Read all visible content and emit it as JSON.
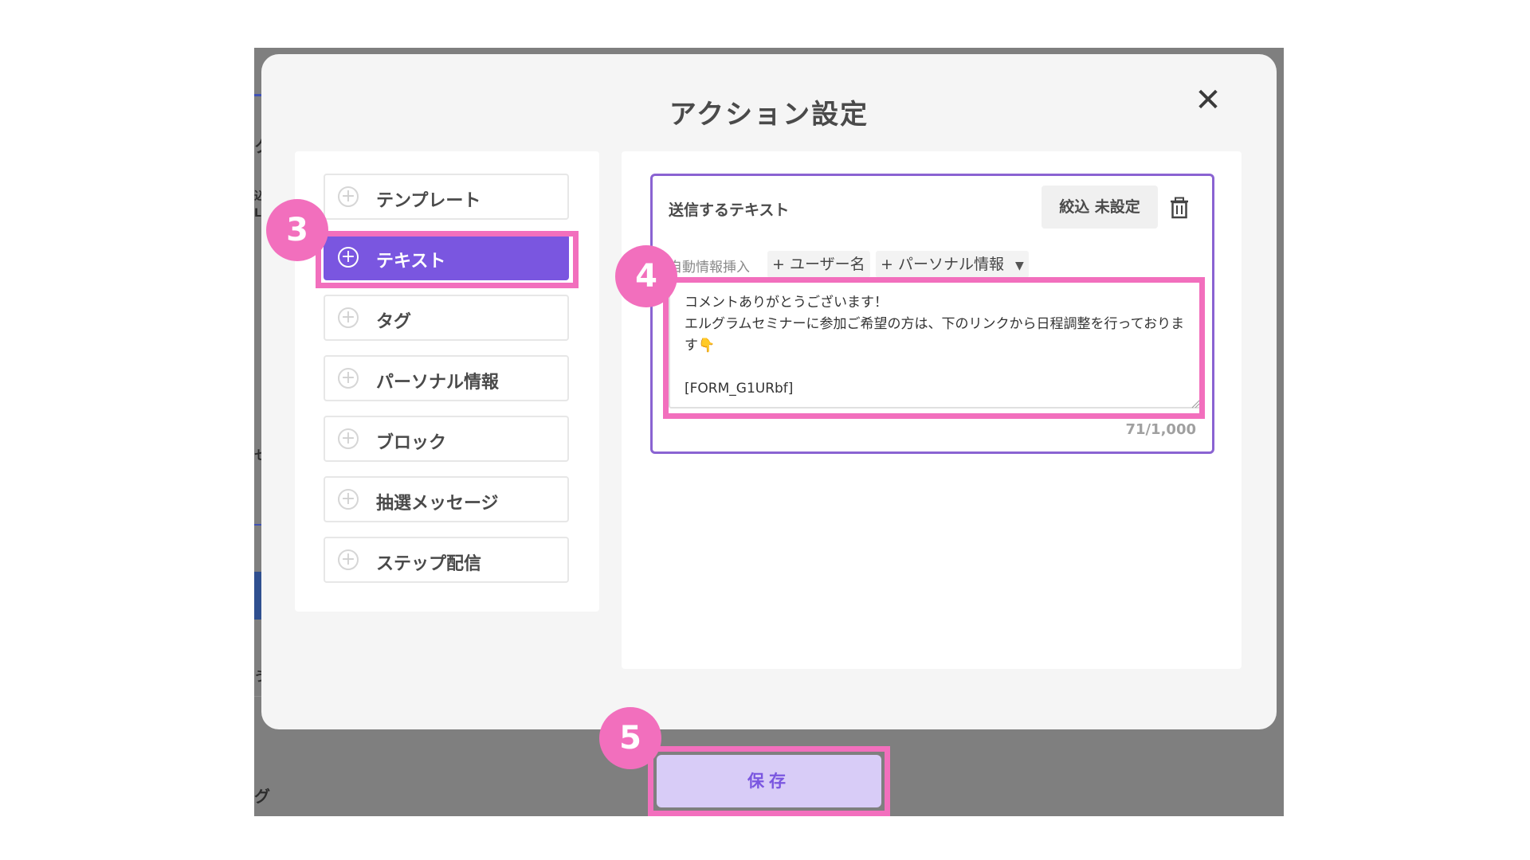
{
  "modal": {
    "title": "アクション設定"
  },
  "action_list": [
    {
      "label": "テンプレート",
      "active": false
    },
    {
      "label": "テキスト",
      "active": true
    },
    {
      "label": "タグ",
      "active": false
    },
    {
      "label": "パーソナル情報",
      "active": false
    },
    {
      "label": "ブロック",
      "active": false
    },
    {
      "label": "抽選メッセージ",
      "active": false
    },
    {
      "label": "ステップ配信",
      "active": false
    }
  ],
  "text_card": {
    "title": "送信するテキスト",
    "filter_label": "絞込 未設定",
    "auto_insert_label": "自動情報挿入",
    "chip_user_name": "+ ユーザー名",
    "chip_personal_info": "+ パーソナル情報",
    "message": "コメントありがとうございます！\nエルグラムセミナーに参加ご希望の方は、下のリンクから日程調整を行っております👇\n\n[FORM_G1URbf]",
    "char_count": "71/1,000"
  },
  "save_label": "保存",
  "badges": {
    "step3": "3",
    "step4": "4",
    "step5": "5"
  },
  "colors": {
    "accent": "#7a56e0",
    "highlight": "#f26fbd",
    "save_bg": "#d8ccf7",
    "backdrop": "#7f7f7f"
  }
}
